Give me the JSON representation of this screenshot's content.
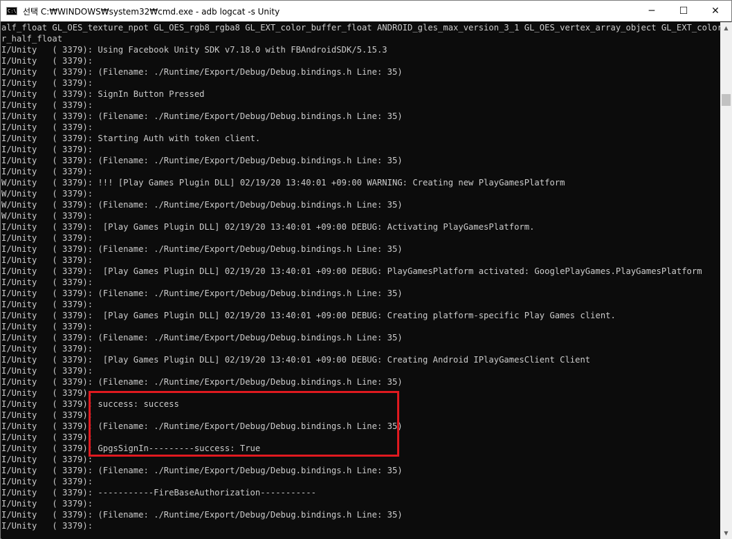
{
  "window": {
    "title": "선택 C:₩WINDOWS₩system32₩cmd.exe - adb  logcat -s Unity",
    "icon_text": "C:\\",
    "minimize_symbol": "─",
    "maximize_symbol": "☐",
    "close_symbol": "✕"
  },
  "console": {
    "lines": [
      "alf_float GL_OES_texture_npot GL_OES_rgb8_rgba8 GL_EXT_color_buffer_float ANDROID_gles_max_version_3_1 GL_OES_vertex_array_object GL_EXT_color_buffe",
      "r_half_float",
      "I/Unity   ( 3379): Using Facebook Unity SDK v7.18.0 with FBAndroidSDK/5.15.3",
      "I/Unity   ( 3379):",
      "I/Unity   ( 3379): (Filename: ./Runtime/Export/Debug/Debug.bindings.h Line: 35)",
      "I/Unity   ( 3379):",
      "I/Unity   ( 3379): SignIn Button Pressed",
      "I/Unity   ( 3379):",
      "I/Unity   ( 3379): (Filename: ./Runtime/Export/Debug/Debug.bindings.h Line: 35)",
      "I/Unity   ( 3379):",
      "I/Unity   ( 3379): Starting Auth with token client.",
      "I/Unity   ( 3379):",
      "I/Unity   ( 3379): (Filename: ./Runtime/Export/Debug/Debug.bindings.h Line: 35)",
      "I/Unity   ( 3379):",
      "W/Unity   ( 3379): !!! [Play Games Plugin DLL] 02/19/20 13:40:01 +09:00 WARNING: Creating new PlayGamesPlatform",
      "W/Unity   ( 3379):",
      "W/Unity   ( 3379): (Filename: ./Runtime/Export/Debug/Debug.bindings.h Line: 35)",
      "W/Unity   ( 3379):",
      "I/Unity   ( 3379):  [Play Games Plugin DLL] 02/19/20 13:40:01 +09:00 DEBUG: Activating PlayGamesPlatform.",
      "I/Unity   ( 3379):",
      "I/Unity   ( 3379): (Filename: ./Runtime/Export/Debug/Debug.bindings.h Line: 35)",
      "I/Unity   ( 3379):",
      "I/Unity   ( 3379):  [Play Games Plugin DLL] 02/19/20 13:40:01 +09:00 DEBUG: PlayGamesPlatform activated: GooglePlayGames.PlayGamesPlatform",
      "I/Unity   ( 3379):",
      "I/Unity   ( 3379): (Filename: ./Runtime/Export/Debug/Debug.bindings.h Line: 35)",
      "I/Unity   ( 3379):",
      "I/Unity   ( 3379):  [Play Games Plugin DLL] 02/19/20 13:40:01 +09:00 DEBUG: Creating platform-specific Play Games client.",
      "I/Unity   ( 3379):",
      "I/Unity   ( 3379): (Filename: ./Runtime/Export/Debug/Debug.bindings.h Line: 35)",
      "I/Unity   ( 3379):",
      "I/Unity   ( 3379):  [Play Games Plugin DLL] 02/19/20 13:40:01 +09:00 DEBUG: Creating Android IPlayGamesClient Client",
      "I/Unity   ( 3379):",
      "I/Unity   ( 3379): (Filename: ./Runtime/Export/Debug/Debug.bindings.h Line: 35)",
      "I/Unity   ( 3379):",
      "I/Unity   ( 3379): success: success",
      "I/Unity   ( 3379):",
      "I/Unity   ( 3379): (Filename: ./Runtime/Export/Debug/Debug.bindings.h Line: 35)",
      "I/Unity   ( 3379):",
      "I/Unity   ( 3379): GpgsSignIn---------success: True",
      "I/Unity   ( 3379):",
      "I/Unity   ( 3379): (Filename: ./Runtime/Export/Debug/Debug.bindings.h Line: 35)",
      "I/Unity   ( 3379):",
      "I/Unity   ( 3379): -----------FireBaseAuthorization-----------",
      "I/Unity   ( 3379):",
      "I/Unity   ( 3379): (Filename: ./Runtime/Export/Debug/Debug.bindings.h Line: 35)",
      "I/Unity   ( 3379):"
    ]
  },
  "colors": {
    "console_background": "#0c0c0c",
    "console_text": "#cccccc",
    "highlight_border": "#e0191f"
  },
  "scrollbar": {
    "up_symbol": "▲",
    "down_symbol": "▼"
  }
}
